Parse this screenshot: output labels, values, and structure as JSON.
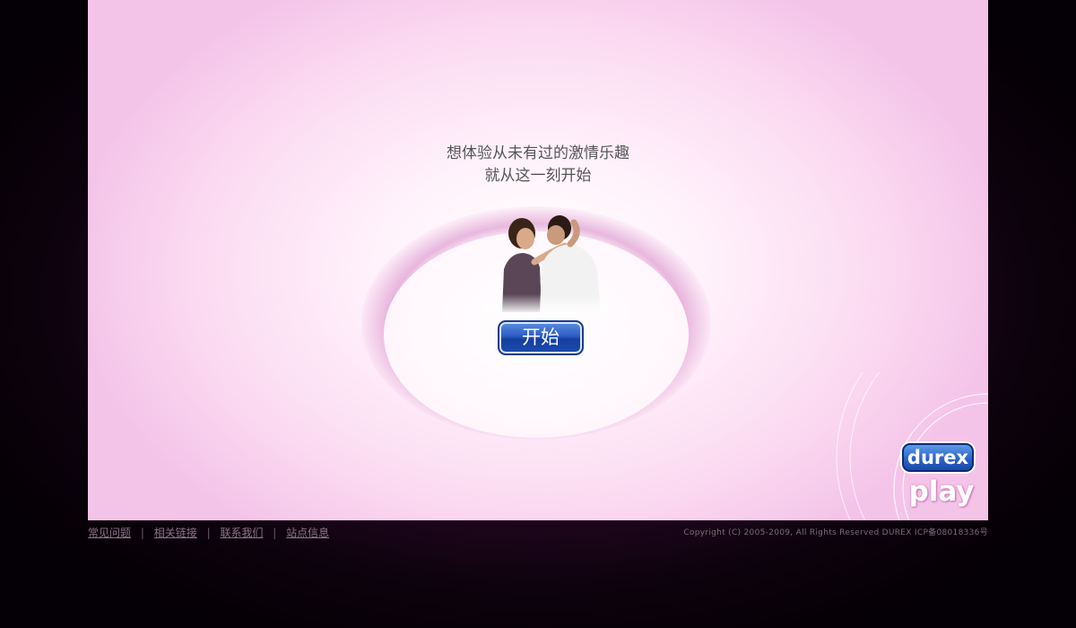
{
  "tagline": {
    "line1": "想体验从未有过的激情乐趣",
    "line2": "就从这一刻开始"
  },
  "start_button": {
    "label": "开始"
  },
  "logo": {
    "brand": "durex",
    "product": "play"
  },
  "footer": {
    "links": [
      {
        "label": "常见问题"
      },
      {
        "label": "相关链接"
      },
      {
        "label": "联系我们"
      },
      {
        "label": "站点信息"
      }
    ],
    "separator": "|",
    "copyright": "Copyright (C) 2005-2009, All Rights Reserved DUREX ICP备08018336号"
  },
  "colors": {
    "stage_pink": "#f8d3ef",
    "button_blue": "#2c5cc4",
    "background_dark": "#1a0518"
  }
}
